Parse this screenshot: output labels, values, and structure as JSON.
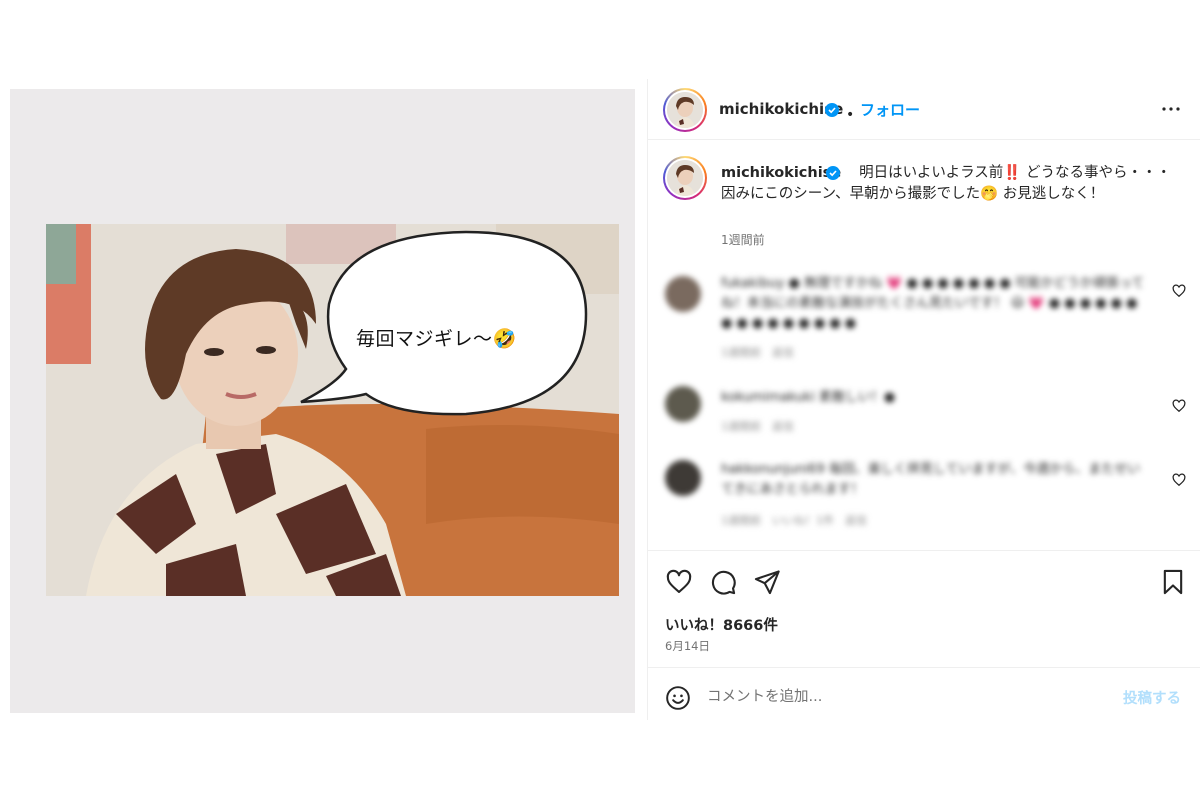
{
  "post": {
    "username": "michikokichise",
    "follow_label": "フォロー",
    "dot": "•",
    "caption": "明日はいよいよラス前‼️ どうなる事やら・・・因みにこのシーン、早朝から撮影でした🤭 お見逃しなく！",
    "caption_time": "1週間前",
    "image_bubble_text": "毎回マジギレ〜🤣",
    "likes_label": "いいね！8666件",
    "date_label": "6月14日"
  },
  "comments": [
    {
      "text": "fukakibuy ● 無理ですかね 💗 ● ● ● ● ● ● ● 可能かどうか頑張ってね！本当にの素敵な演技がたくさん見たいです！ 😃 💗 ● ● ● ● ● ● ● ● ● ● ● ● ● ● ●",
      "meta": "1週間前　返信"
    },
    {
      "text": "kokumimakuki 素敵しい！●",
      "meta": "1週間前　返信"
    },
    {
      "text": "hakkonunjuni69 毎回、楽しく拝見していますが、今週から、またせいてきにあさとられます！",
      "meta": "1週間前　いいね！1件　返信"
    }
  ],
  "add_comment": {
    "placeholder": "コメントを追加...",
    "post_label": "投稿する"
  },
  "colors": {
    "accent_blue": "#0095f6",
    "post_disabled": "#b2dffc",
    "verified": "#0095f6"
  },
  "icons": [
    "more-options-icon",
    "verified-badge-icon",
    "heart-icon",
    "comment-icon",
    "share-icon",
    "bookmark-icon",
    "emoji-icon"
  ]
}
